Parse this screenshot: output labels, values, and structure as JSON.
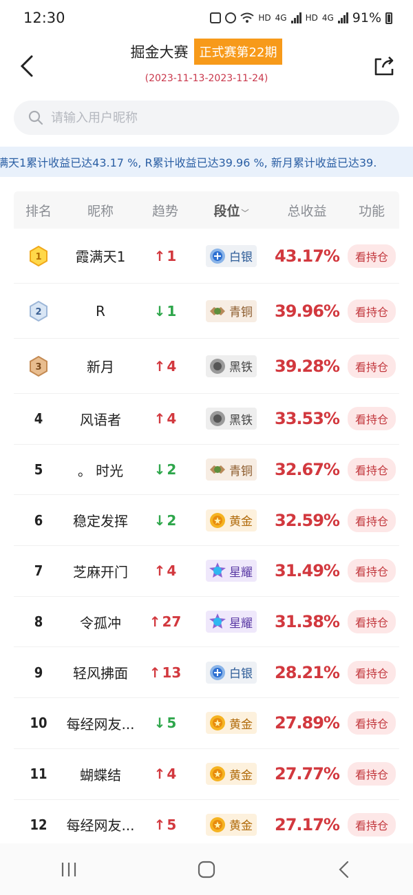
{
  "status_bar": {
    "time": "12:30",
    "network_1": "HD",
    "network_1_gen": "4G",
    "network_2": "HD",
    "network_2_gen": "4G",
    "battery_text": "91%",
    "icons": [
      "notification-icon",
      "alarm-icon",
      "wifi-icon",
      "signal-icon",
      "battery-icon"
    ]
  },
  "header": {
    "title": "掘金大赛",
    "badge": "正式赛第22期",
    "date_range": "(2023-11-13-2023-11-24)",
    "badge_color": "#f79a1a",
    "date_color": "#c9374b"
  },
  "search": {
    "placeholder": "请输入用户昵称",
    "value": ""
  },
  "marquee": {
    "text": "满天1累计收益已达43.17 %, R累计收益已达39.96 %, 新月累计收益已达39."
  },
  "table": {
    "headers": {
      "rank": "排名",
      "nickname": "昵称",
      "trend": "趋势",
      "tier": "段位",
      "profit": "总收益",
      "action": "功能"
    },
    "rows": [
      {
        "rank": "1",
        "medal": "gold",
        "nickname": "霞满天1",
        "trend_dir": "up",
        "trend_value": "1",
        "tier": "白银",
        "tier_class": "silver",
        "profit": "43.17%",
        "action": "看持仓"
      },
      {
        "rank": "2",
        "medal": "silver",
        "nickname": "R",
        "trend_dir": "down",
        "trend_value": "1",
        "tier": "青铜",
        "tier_class": "bronze",
        "profit": "39.96%",
        "action": "看持仓"
      },
      {
        "rank": "3",
        "medal": "bronze",
        "nickname": "新月",
        "trend_dir": "up",
        "trend_value": "4",
        "tier": "黑铁",
        "tier_class": "iron",
        "profit": "39.28%",
        "action": "看持仓"
      },
      {
        "rank": "4",
        "medal": "",
        "nickname": "风语者",
        "trend_dir": "up",
        "trend_value": "4",
        "tier": "黑铁",
        "tier_class": "iron",
        "profit": "33.53%",
        "action": "看持仓"
      },
      {
        "rank": "5",
        "medal": "",
        "nickname": "。 时光",
        "trend_dir": "down",
        "trend_value": "2",
        "tier": "青铜",
        "tier_class": "bronze",
        "profit": "32.67%",
        "action": "看持仓"
      },
      {
        "rank": "6",
        "medal": "",
        "nickname": "稳定发挥",
        "trend_dir": "down",
        "trend_value": "2",
        "tier": "黄金",
        "tier_class": "gold",
        "profit": "32.59%",
        "action": "看持仓"
      },
      {
        "rank": "7",
        "medal": "",
        "nickname": "芝麻开门",
        "trend_dir": "up",
        "trend_value": "4",
        "tier": "星耀",
        "tier_class": "star",
        "profit": "31.49%",
        "action": "看持仓"
      },
      {
        "rank": "8",
        "medal": "",
        "nickname": "令孤冲",
        "trend_dir": "up",
        "trend_value": "27",
        "tier": "星耀",
        "tier_class": "star",
        "profit": "31.38%",
        "action": "看持仓"
      },
      {
        "rank": "9",
        "medal": "",
        "nickname": "轻风拂面",
        "trend_dir": "up",
        "trend_value": "13",
        "tier": "白银",
        "tier_class": "silver",
        "profit": "28.21%",
        "action": "看持仓"
      },
      {
        "rank": "10",
        "medal": "",
        "nickname": "每经网友...",
        "trend_dir": "down",
        "trend_value": "5",
        "tier": "黄金",
        "tier_class": "gold",
        "profit": "27.89%",
        "action": "看持仓"
      },
      {
        "rank": "11",
        "medal": "",
        "nickname": "蝴蝶结",
        "trend_dir": "up",
        "trend_value": "4",
        "tier": "黄金",
        "tier_class": "gold",
        "profit": "27.77%",
        "action": "看持仓"
      },
      {
        "rank": "12",
        "medal": "",
        "nickname": "每经网友...",
        "trend_dir": "up",
        "trend_value": "5",
        "tier": "黄金",
        "tier_class": "gold",
        "profit": "27.17%",
        "action": "看持仓"
      }
    ]
  },
  "colors": {
    "profit": "#d2383e",
    "trend_up": "#d2383e",
    "trend_down": "#2ea64b"
  },
  "nav": {
    "icons": [
      "recent-apps-icon",
      "home-icon",
      "back-nav-icon"
    ]
  }
}
